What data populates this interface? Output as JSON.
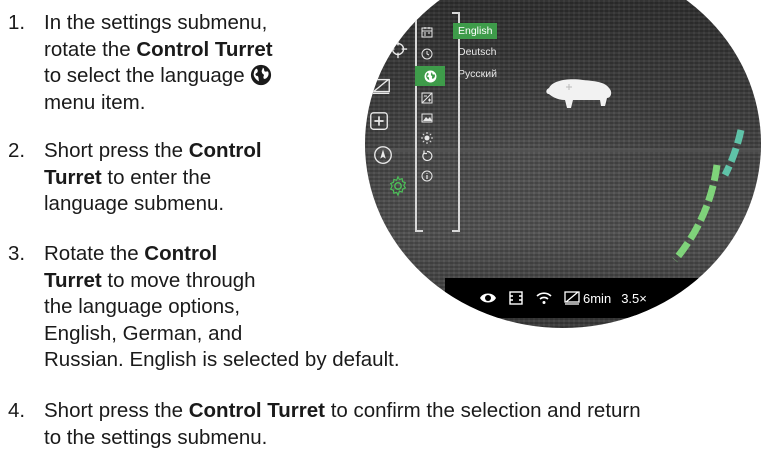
{
  "steps": [
    {
      "num": "1.",
      "lines": [
        "In the settings submenu,",
        "rotate the ",
        "Control Turret",
        "to select the language",
        "menu item."
      ]
    },
    {
      "num": "2.",
      "lines": [
        "Short press the ",
        "Control",
        "Turret",
        " to enter the",
        "language submenu."
      ]
    },
    {
      "num": "3.",
      "lines": [
        "Rotate the ",
        "Control",
        "Turret",
        " to move through",
        "the language options,",
        "English, German, and",
        "Russian. English is selected by default."
      ]
    },
    {
      "num": "4.",
      "lines": [
        "Short press the ",
        "Control Turret",
        " to confirm the selection and return",
        "to the settings submenu."
      ]
    }
  ],
  "languages": [
    "English",
    "Deutsch",
    "Русский"
  ],
  "selected_language": "English",
  "status": {
    "battery_time": "6min",
    "zoom": "3.5×"
  },
  "colors": {
    "accent_green": "#3e9c4a",
    "text": "#1a1a1a",
    "scope_bg": "#3a3a3a"
  },
  "icons": {
    "inline": "globe-icon",
    "left_column": [
      "crosshair-icon",
      "display-off-icon",
      "add-icon",
      "compass-icon",
      "gear-icon"
    ],
    "submenu": [
      "calendar-icon",
      "clock-icon",
      "globe-icon",
      "exposure-icon",
      "picture-icon",
      "brightness-icon",
      "restore-icon",
      "info-icon"
    ],
    "statusbar": [
      "eye-icon",
      "record-icon",
      "wifi-icon",
      "display-off-icon"
    ]
  }
}
